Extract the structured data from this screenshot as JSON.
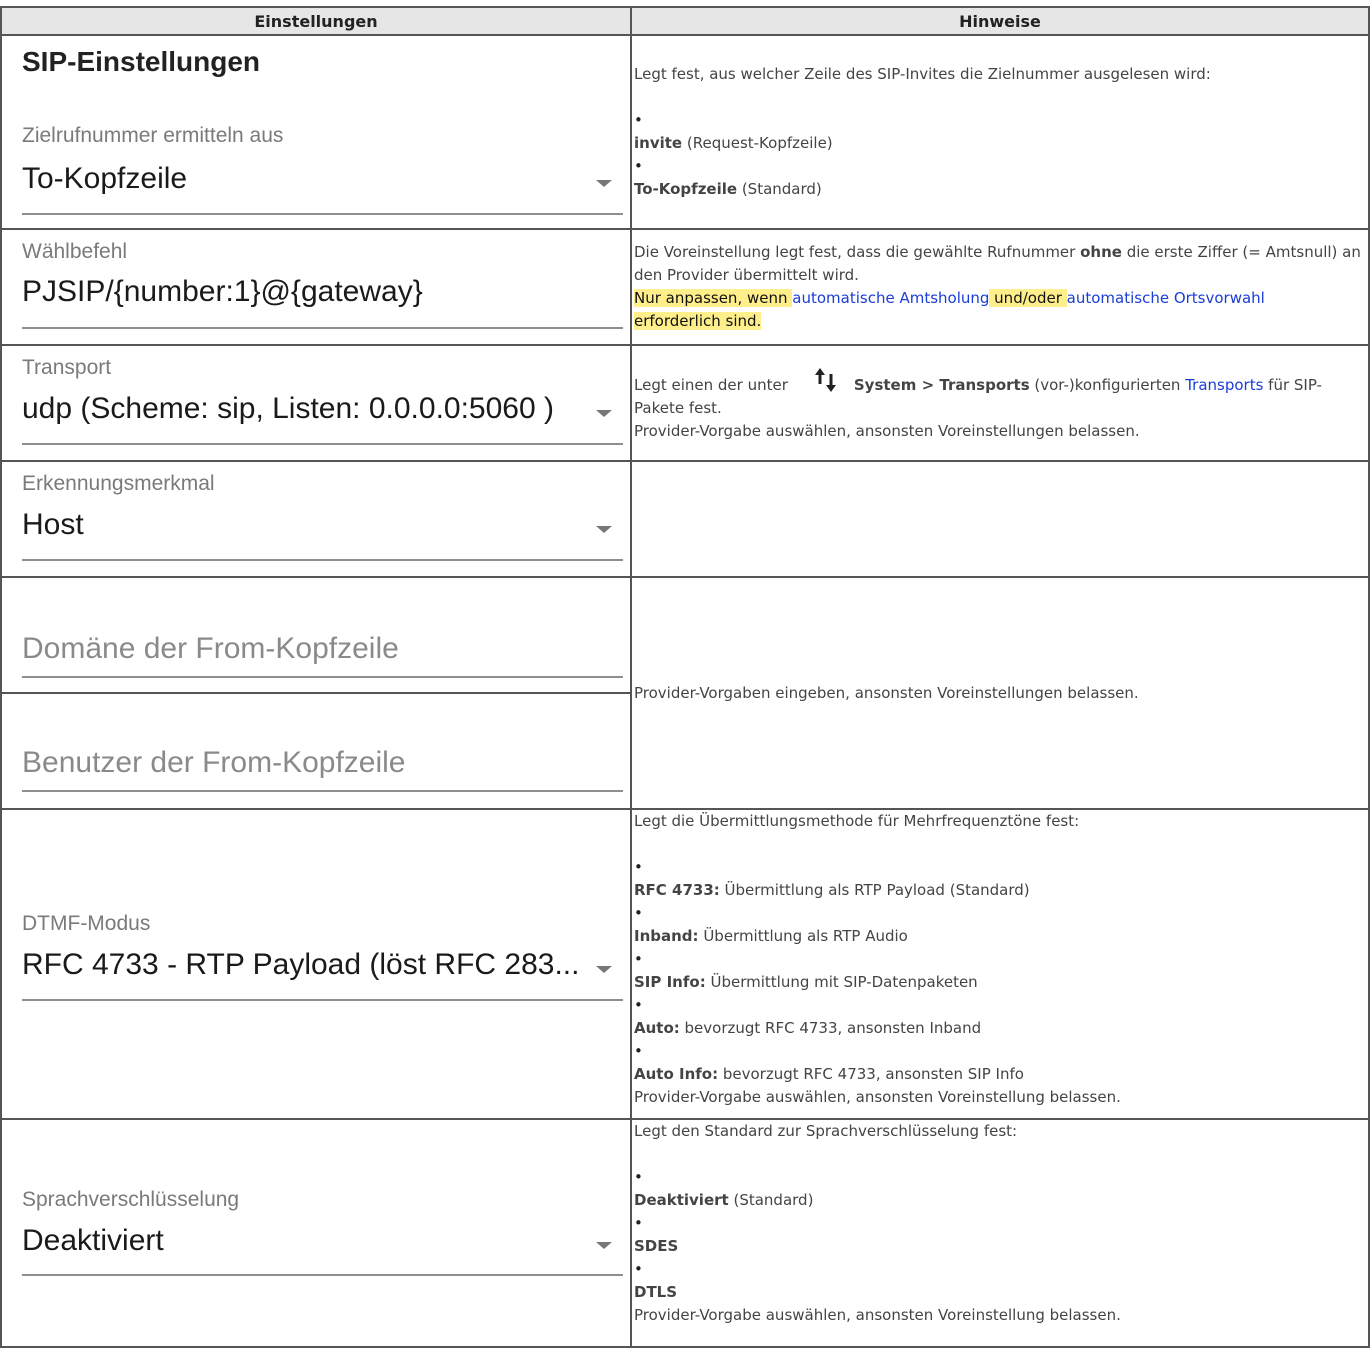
{
  "headers": {
    "settings": "Einstellungen",
    "notes": "Hinweise"
  },
  "section_title": "SIP-Einstellungen",
  "fields": {
    "zielrufnummer": {
      "label": "Zielrufnummer ermitteln aus",
      "value": "To-Kopfzeile"
    },
    "waehlbefehl": {
      "label": "Wählbefehl",
      "value": "PJSIP/{number:1}@{gateway}"
    },
    "transport": {
      "label": "Transport",
      "value": "udp (Scheme: sip, Listen: 0.0.0.0:5060 )"
    },
    "erkennung": {
      "label": "Erkennungsmerkmal",
      "value": "Host"
    },
    "from_domain": {
      "placeholder": "Domäne der From-Kopfzeile"
    },
    "from_user": {
      "placeholder": "Benutzer der From-Kopfzeile"
    },
    "dtmf": {
      "label": "DTMF-Modus",
      "value": "RFC 4733 - RTP Payload (löst RFC 283..."
    },
    "sprach": {
      "label": "Sprachverschlüsselung",
      "value": "Deaktiviert"
    }
  },
  "notes": {
    "ziel": {
      "intro": "Legt fest, aus welcher Zeile des SIP-Invites die Zielnummer ausgelesen wird:",
      "items": [
        {
          "bold": "invite",
          "rest": " (Request-Kopfzeile)"
        },
        {
          "bold": "To-Kopfzeile",
          "rest": " (Standard)"
        }
      ]
    },
    "waehl": {
      "p1_a": "Die Voreinstellung legt fest, dass die gewählte Rufnummer ",
      "p1_bold": "ohne",
      "p1_b": " die erste Ziffer (= Amtsnull) an den Provider übermittelt wird.",
      "hl_a": "Nur anpassen, wenn ",
      "link1": "automatische Amtsholung",
      "hl_b": " und/oder ",
      "link2": "automatische Ortsvorwahl",
      "hl_c": "erforderlich sind."
    },
    "transport": {
      "a": "Legt einen der unter",
      "bold": "System > Transports",
      "b": " (vor-)konfigurierten ",
      "link": "Transports",
      "c": " für SIP-Pakete fest.",
      "line2": "Provider-Vorgabe auswählen, ansonsten Voreinstellungen belassen."
    },
    "from": "Provider-Vorgaben eingeben, ansonsten Voreinstellungen belassen.",
    "dtmf": {
      "intro": "Legt die Übermittlungsmethode für Mehrfrequenztöne fest:",
      "items": [
        {
          "bold": "RFC 4733:",
          "rest": " Übermittlung als RTP Payload (Standard)"
        },
        {
          "bold": "Inband:",
          "rest": " Übermittlung als RTP Audio"
        },
        {
          "bold": "SIP Info:",
          "rest": " Übermittlung mit SIP-Datenpaketen"
        },
        {
          "bold": "Auto:",
          "rest": " bevorzugt RFC 4733, ansonsten Inband"
        },
        {
          "bold": "Auto Info:",
          "rest": " bevorzugt RFC 4733, ansonsten SIP Info"
        }
      ],
      "outro": "Provider-Vorgabe auswählen, ansonsten Voreinstellung belassen."
    },
    "sprach": {
      "intro": "Legt den Standard zur Sprachverschlüsselung fest:",
      "items": [
        {
          "bold": "Deaktiviert",
          "rest": " (Standard)"
        },
        {
          "bold": "SDES",
          "rest": ""
        },
        {
          "bold": "DTLS",
          "rest": ""
        }
      ],
      "outro": "Provider-Vorgabe auswählen, ansonsten Voreinstellung belassen."
    }
  },
  "bullet": "•",
  "icons": {
    "transport_icon": "arrows-up-down-icon",
    "dropdown": "triangle-down-icon"
  },
  "colors": {
    "link": "#1a3dd6",
    "highlight": "#ffef8a",
    "header_bg": "#e6e6e6"
  }
}
